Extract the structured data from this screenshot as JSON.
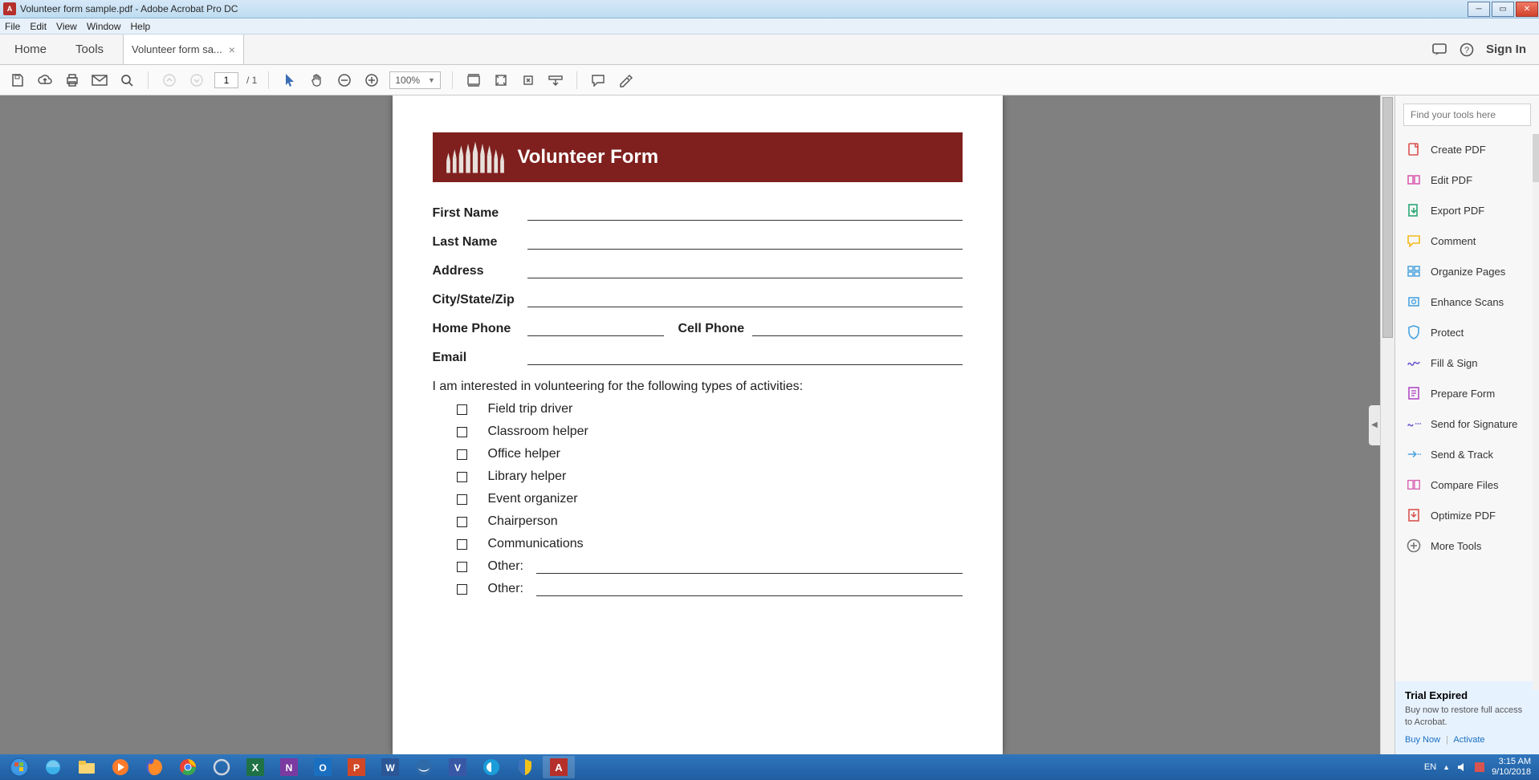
{
  "titlebar": {
    "app_icon_letter": "A",
    "title": "Volunteer form sample.pdf - Adobe Acrobat Pro DC"
  },
  "menubar": [
    "File",
    "Edit",
    "View",
    "Window",
    "Help"
  ],
  "tabstrip": {
    "home": "Home",
    "tools": "Tools",
    "tab_label": "Volunteer form sa...",
    "tab_close": "×",
    "signin": "Sign In"
  },
  "toolbar": {
    "page_current": "1",
    "page_total": "/ 1",
    "zoom_value": "100%"
  },
  "document": {
    "header_title": "Volunteer Form",
    "fields": {
      "first_name": "First Name",
      "last_name": "Last Name",
      "address": "Address",
      "city_state_zip": "City/State/Zip",
      "home_phone": "Home Phone",
      "cell_phone": "Cell Phone",
      "email": "Email"
    },
    "intro": "I am interested in volunteering for the following types of activities:",
    "checkboxes": [
      "Field trip driver",
      "Classroom helper",
      "Office helper",
      "Library helper",
      "Event organizer",
      "Chairperson",
      "Communications",
      "Other:",
      "Other:"
    ]
  },
  "tools_pane": {
    "search_placeholder": "Find your tools here",
    "items": [
      {
        "label": "Create PDF",
        "color": "#d9534f",
        "icon": "create"
      },
      {
        "label": "Edit PDF",
        "color": "#d85db0",
        "icon": "edit"
      },
      {
        "label": "Export PDF",
        "color": "#2aa876",
        "icon": "export"
      },
      {
        "label": "Comment",
        "color": "#f2b91f",
        "icon": "comment"
      },
      {
        "label": "Organize Pages",
        "color": "#4aa3df",
        "icon": "organize"
      },
      {
        "label": "Enhance Scans",
        "color": "#4aa3df",
        "icon": "enhance"
      },
      {
        "label": "Protect",
        "color": "#4aa3df",
        "icon": "protect"
      },
      {
        "label": "Fill & Sign",
        "color": "#6b5bd2",
        "icon": "fillsign"
      },
      {
        "label": "Prepare Form",
        "color": "#b04bc4",
        "icon": "prepare"
      },
      {
        "label": "Send for Signature",
        "color": "#6b5bd2",
        "icon": "sendsig"
      },
      {
        "label": "Send & Track",
        "color": "#4aa3df",
        "icon": "sendtrack"
      },
      {
        "label": "Compare Files",
        "color": "#d85db0",
        "icon": "compare"
      },
      {
        "label": "Optimize PDF",
        "color": "#d9534f",
        "icon": "optimize"
      },
      {
        "label": "More Tools",
        "color": "#777",
        "icon": "more"
      }
    ],
    "trial": {
      "title": "Trial Expired",
      "text": "Buy now to restore full access to Acrobat.",
      "buy": "Buy Now",
      "activate": "Activate"
    }
  },
  "tray": {
    "lang": "EN",
    "time": "3:15 AM",
    "date": "9/10/2018"
  }
}
